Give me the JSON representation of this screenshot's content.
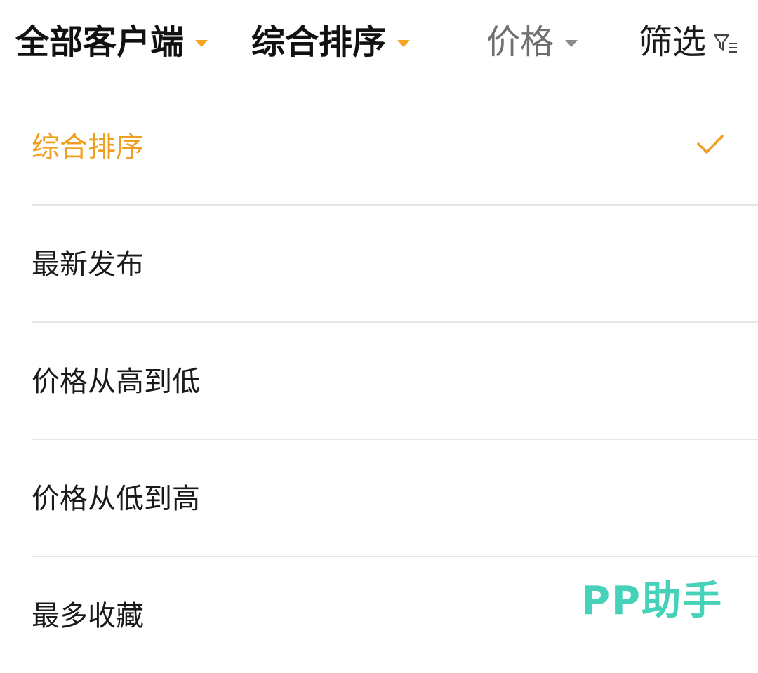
{
  "filter_bar": {
    "all_clients": "全部客户端",
    "sort": "综合排序",
    "price": "价格",
    "filter": "筛选",
    "filter_icon": "funnel-list-icon",
    "caret_icon": "triangle-down-icon"
  },
  "sort_options": [
    {
      "label": "综合排序",
      "selected": true
    },
    {
      "label": "最新发布",
      "selected": false
    },
    {
      "label": "价格从高到低",
      "selected": false
    },
    {
      "label": "价格从低到高",
      "selected": false
    },
    {
      "label": "最多收藏",
      "selected": false
    }
  ],
  "check_icon": "checkmark-icon",
  "watermark": "PP助手",
  "colors": {
    "accent": "#f5a623",
    "selected_text": "#f0a020",
    "divider": "#e6e6e6",
    "muted": "#6f6f6f",
    "watermark": "#45d2b8"
  }
}
